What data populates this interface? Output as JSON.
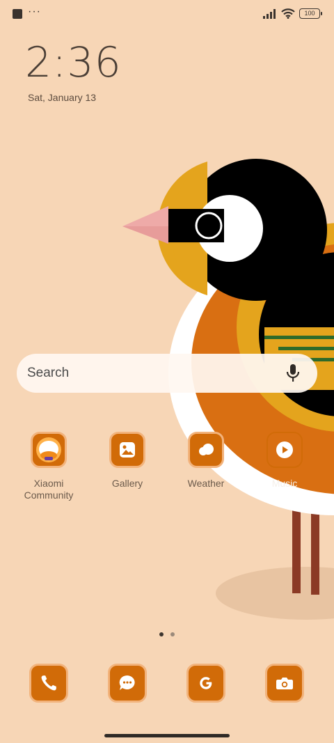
{
  "status_bar": {
    "more_indicator": "···",
    "battery": "100",
    "icons": [
      "notification-icon",
      "signal-icon",
      "wifi-icon",
      "battery-icon"
    ]
  },
  "clock": {
    "time": "2:36",
    "date": "Sat, January 13"
  },
  "search": {
    "placeholder": "Search",
    "icon": "mic-icon"
  },
  "apps": [
    {
      "label": "Xiaomi Community",
      "icon": "xiaomi-community-icon"
    },
    {
      "label": "Gallery",
      "icon": "gallery-icon"
    },
    {
      "label": "Weather",
      "icon": "weather-icon"
    },
    {
      "label": "Music",
      "icon": "music-icon"
    }
  ],
  "page_indicator": {
    "pages": 2,
    "current": 1
  },
  "dock": [
    {
      "icon": "phone-icon"
    },
    {
      "icon": "messages-icon"
    },
    {
      "icon": "google-icon"
    },
    {
      "icon": "camera-icon"
    }
  ],
  "colors": {
    "background": "#f7d6b6",
    "accent": "#d16b08"
  }
}
